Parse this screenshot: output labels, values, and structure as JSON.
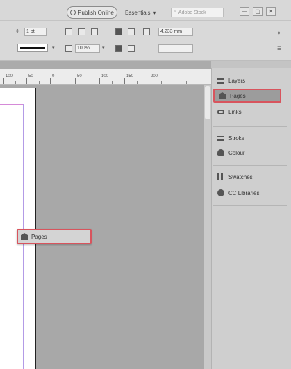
{
  "topbar": {
    "publish_label": "Publish Online",
    "workspace_label": "Essentials",
    "search_placeholder": "Adobe Stock",
    "window_controls": [
      "—",
      "▢",
      "✕"
    ]
  },
  "control": {
    "font_size_value": "1 pt",
    "tint_value": "100%",
    "offset_value": "4.233 mm"
  },
  "ruler": {
    "labels": [
      "100",
      "50",
      "0",
      "50",
      "100",
      "150",
      "200"
    ]
  },
  "floating_panel": {
    "label": "Pages",
    "icon": "pages-icon"
  },
  "dock": {
    "items": [
      {
        "label": "Layers",
        "icon": "layers-icon"
      },
      {
        "label": "Pages",
        "icon": "pages-icon",
        "active": true
      },
      {
        "label": "Links",
        "icon": "links-icon"
      },
      {
        "label": "Stroke",
        "icon": "stroke-icon"
      },
      {
        "label": "Colour",
        "icon": "colour-icon"
      },
      {
        "label": "Swatches",
        "icon": "swatches-icon"
      },
      {
        "label": "CC Libraries",
        "icon": "cc-libraries-icon"
      }
    ]
  },
  "colors": {
    "highlight": "#d8545d",
    "pasteboard": "#a8a8a8",
    "page": "#ffffff",
    "margin_guide": "#d58ad8"
  }
}
